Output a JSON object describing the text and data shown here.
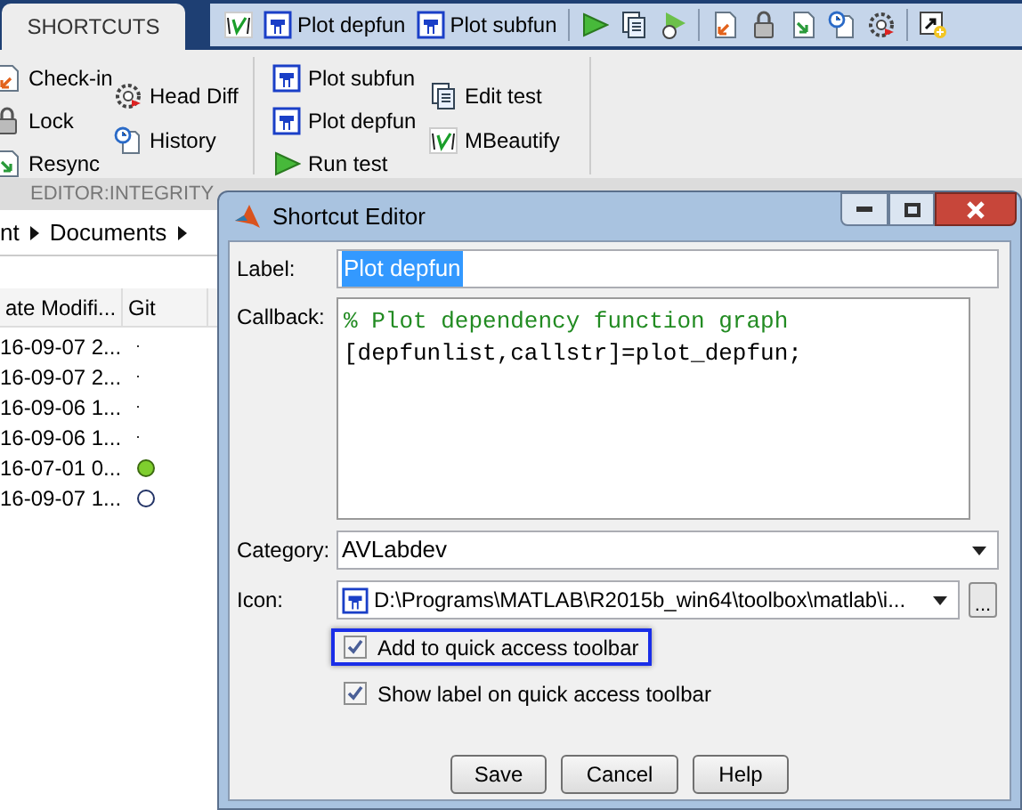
{
  "ribbon": {
    "tabs": [
      {
        "label": "SHORTCUTS",
        "selected": true
      }
    ],
    "quick_access": [
      {
        "kind": "mbeautify"
      },
      {
        "kind": "plot",
        "label": "Plot depfun"
      },
      {
        "kind": "plot",
        "label": "Plot subfun"
      },
      {
        "kind": "sep"
      },
      {
        "kind": "run"
      },
      {
        "kind": "doc"
      },
      {
        "kind": "timer"
      },
      {
        "kind": "sep"
      },
      {
        "kind": "checkin"
      },
      {
        "kind": "lock"
      },
      {
        "kind": "resync"
      },
      {
        "kind": "history"
      },
      {
        "kind": "diff"
      },
      {
        "kind": "sep"
      },
      {
        "kind": "new"
      }
    ],
    "groups": [
      [
        {
          "kind": "checkin",
          "label": "Check-in"
        },
        {
          "kind": "lock",
          "label": "Lock"
        },
        {
          "kind": "resync",
          "label": "Resync"
        }
      ],
      [
        {
          "kind": "diff",
          "label": "Head Diff"
        },
        {
          "kind": "history",
          "label": "History"
        }
      ],
      [
        {
          "kind": "plot",
          "label": "Plot subfun"
        },
        {
          "kind": "plot",
          "label": "Plot depfun"
        },
        {
          "kind": "run",
          "label": "Run test"
        }
      ],
      [
        {
          "kind": "doc",
          "label": "Edit test"
        },
        {
          "kind": "mbeautify",
          "label": "MBeautify"
        }
      ]
    ],
    "section_label": "EDITOR:INTEGRITY"
  },
  "breadcrumb": [
    "nt",
    "Documents"
  ],
  "file_list": {
    "columns": [
      "ate Modifi...",
      "Git"
    ],
    "rows": [
      {
        "date": "16-09-07 2...",
        "kind": "dot"
      },
      {
        "date": "16-09-07 2...",
        "kind": "dot"
      },
      {
        "date": "16-09-06 1...",
        "kind": "dot"
      },
      {
        "date": "16-09-06 1...",
        "kind": "dot"
      },
      {
        "date": "16-07-01 0...",
        "kind": "filled",
        "color": "#7fce2e"
      },
      {
        "date": "16-09-07 1...",
        "kind": "hollow"
      }
    ]
  },
  "dialog": {
    "title": "Shortcut Editor",
    "label_field": {
      "label": "Label:",
      "value": "Plot depfun",
      "selected": true
    },
    "callback": {
      "label": "Callback:",
      "lines": [
        {
          "kind": "comment",
          "text": "% Plot dependency function graph"
        },
        {
          "kind": "code",
          "text": "[depfunlist,callstr]=plot_depfun;"
        }
      ]
    },
    "category": {
      "label": "Category:",
      "value": "AVLabdev"
    },
    "icon": {
      "label": "Icon:",
      "value": "D:\\Programs\\MATLAB\\R2015b_win64\\toolbox\\matlab\\i...",
      "browse": "..."
    },
    "checkboxes": [
      {
        "label": "Add to quick access toolbar",
        "checked": true,
        "focused": true
      },
      {
        "label": "Show label on quick access toolbar",
        "checked": true,
        "focused": false
      }
    ],
    "buttons": [
      "Save",
      "Cancel",
      "Help"
    ]
  }
}
